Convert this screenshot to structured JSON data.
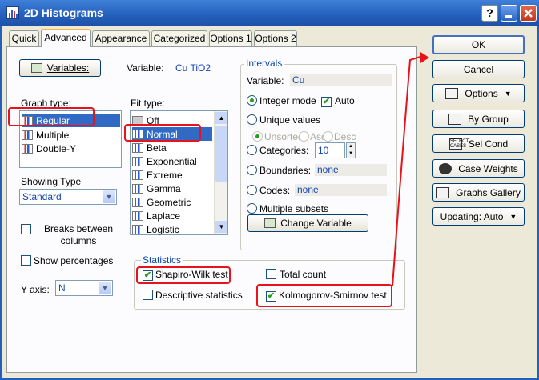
{
  "window": {
    "title": "2D Histograms",
    "help_label": "?"
  },
  "tabs": [
    "Quick",
    "Advanced",
    "Appearance",
    "Categorized",
    "Options 1",
    "Options 2"
  ],
  "variables": {
    "button_label": "Variables:",
    "var_label": "Variable:",
    "var_value": "Cu TiO2"
  },
  "graph_type": {
    "label": "Graph type:",
    "items": [
      "Regular",
      "Multiple",
      "Double-Y"
    ],
    "selected": "Regular"
  },
  "fit_type": {
    "label": "Fit type:",
    "items": [
      "Off",
      "Normal",
      "Beta",
      "Exponential",
      "Extreme",
      "Gamma",
      "Geometric",
      "Laplace",
      "Logistic"
    ],
    "selected": "Normal"
  },
  "showing_type": {
    "label": "Showing Type",
    "value": "Standard"
  },
  "breaks_label": "Breaks between columns",
  "show_percentages_label": "Show percentages",
  "yaxis": {
    "label": "Y axis:",
    "value": "N"
  },
  "intervals": {
    "legend": "Intervals",
    "variable_label": "Variable:",
    "variable_value": "Cu",
    "integer_mode_label": "Integer mode",
    "auto_label": "Auto",
    "unique_values_label": "Unique values",
    "unsorted_label": "Unsorted",
    "asc_label": "Asc",
    "desc_label": "Desc",
    "categories_label": "Categories:",
    "categories_value": "10",
    "boundaries_label": "Boundaries:",
    "boundaries_value": "none",
    "codes_label": "Codes:",
    "codes_value": "none",
    "multiple_subsets_label": "Multiple subsets",
    "change_variable_label": "Change Variable"
  },
  "statistics": {
    "legend": "Statistics",
    "shapiro_label": "Shapiro-Wilk test",
    "total_count_label": "Total count",
    "descriptive_label": "Descriptive statistics",
    "ks_label": "Kolmogorov-Smirnov test"
  },
  "right_buttons": {
    "ok": "OK",
    "cancel": "Cancel",
    "options": "Options",
    "by_group": "By Group",
    "sel_cond": "Sel Cond",
    "sel_cond_icon_text": "SELECT CASES",
    "case_weights": "Case Weights",
    "graphs_gallery": "Graphs Gallery",
    "updating": "Updating: Auto"
  },
  "colors": {
    "title_bar": "#245fbd",
    "annotation_red": "#e8121a",
    "selection_blue": "#316ac5",
    "check_green": "#21a121"
  }
}
